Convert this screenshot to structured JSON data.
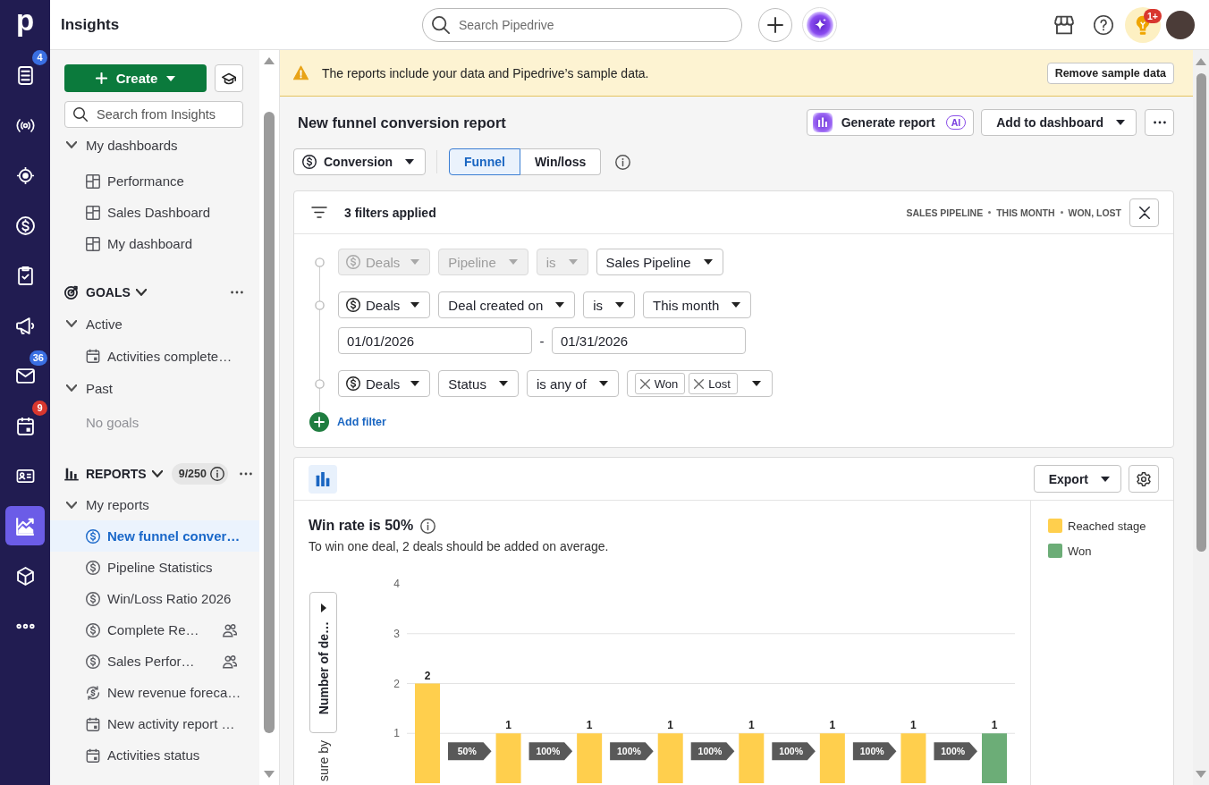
{
  "nav": {
    "logo": "p",
    "items": [
      {
        "kind": "leads",
        "selected": false,
        "badge": {
          "text": "4",
          "color": "#3a6fe2"
        }
      },
      {
        "kind": "broadcast",
        "selected": false
      },
      {
        "kind": "target",
        "selected": false
      },
      {
        "kind": "deals",
        "selected": false
      },
      {
        "kind": "activities",
        "selected": false
      },
      {
        "kind": "campaigns",
        "selected": false
      },
      {
        "kind": "mail",
        "selected": false,
        "badge": {
          "text": "36",
          "color": "#3a6fe2"
        }
      },
      {
        "kind": "calendar",
        "selected": false,
        "badge": {
          "text": "9",
          "color": "#d8372f"
        }
      },
      {
        "kind": "contacts",
        "selected": false
      },
      {
        "kind": "insights",
        "selected": true
      },
      {
        "kind": "products",
        "selected": false
      },
      {
        "kind": "more",
        "selected": false
      }
    ]
  },
  "top_bar": {
    "title": "Insights",
    "search": {
      "placeholder": "Search Pipedrive"
    },
    "tips_badge": "1+"
  },
  "sidebar": {
    "create_button": "Create",
    "search": {
      "placeholder": "Search from Insights"
    },
    "dashboards": {
      "title": "My dashboards",
      "expanded": true,
      "items": [
        {
          "label": "Performance",
          "kind": "dashboard",
          "selected": false
        },
        {
          "label": "Sales Dashboard",
          "kind": "dashboard",
          "selected": false
        },
        {
          "label": "My dashboard",
          "kind": "dashboard",
          "selected": false
        }
      ]
    },
    "goals": {
      "title": "GOALS",
      "expanded": true,
      "groups": [
        {
          "label": "Active",
          "expanded": true,
          "children": [
            {
              "label": "Activities complete…",
              "kind": "activity",
              "selected": false
            }
          ]
        },
        {
          "label": "Past",
          "expanded": true,
          "empty_text": "No goals"
        }
      ]
    },
    "reports": {
      "title": "REPORTS",
      "expanded": true,
      "count": "9/250",
      "groups": [
        {
          "label": "My reports",
          "expanded": true,
          "children": [
            {
              "label": "New funnel conver…",
              "kind": "deal",
              "selected": true,
              "shared": false
            },
            {
              "label": "Pipeline Statistics",
              "kind": "deal",
              "selected": false,
              "shared": false
            },
            {
              "label": "Win/Loss Ratio 2026",
              "kind": "deal",
              "selected": false,
              "shared": false
            },
            {
              "label": "Complete Re…",
              "kind": "deal",
              "selected": false,
              "shared": true
            },
            {
              "label": "Sales Perfor…",
              "kind": "deal",
              "selected": false,
              "shared": true
            },
            {
              "label": "New revenue foreca…",
              "kind": "forecast",
              "selected": false,
              "shared": false
            },
            {
              "label": "New activity report …",
              "kind": "activity",
              "selected": false,
              "shared": false
            },
            {
              "label": "Activities status",
              "kind": "activity",
              "selected": false,
              "shared": false
            }
          ]
        }
      ]
    }
  },
  "banner": {
    "kind": "warning",
    "text": "The reports include your data and Pipedrive’s sample data.",
    "button": "Remove sample data"
  },
  "report": {
    "title": "New funnel conversion report",
    "generate_button": {
      "label": "Generate report",
      "badge": "AI"
    },
    "dashboard_button": "Add to dashboard",
    "type_select": "Conversion",
    "tabs": [
      {
        "label": "Funnel",
        "selected": true
      },
      {
        "label": "Win/loss",
        "selected": false
      }
    ]
  },
  "filters": {
    "title": "3 filters applied",
    "summary": [
      "SALES PIPELINE",
      "THIS MONTH",
      "WON, LOST"
    ],
    "rows": [
      {
        "fields": [
          {
            "kind": "entity",
            "value": "Deals",
            "disabled": true
          },
          {
            "kind": "select",
            "value": "Pipeline",
            "disabled": true
          },
          {
            "kind": "select",
            "value": "is",
            "disabled": true
          },
          {
            "kind": "select",
            "value": "Sales Pipeline",
            "disabled": false
          }
        ]
      },
      {
        "fields": [
          {
            "kind": "entity",
            "value": "Deals",
            "disabled": false
          },
          {
            "kind": "select",
            "value": "Deal created on",
            "disabled": false
          },
          {
            "kind": "select",
            "value": "is",
            "disabled": false
          },
          {
            "kind": "select",
            "value": "This month",
            "disabled": false
          }
        ],
        "date_range": {
          "from": "01/01/2026",
          "separator": "-",
          "to": "01/31/2026"
        }
      },
      {
        "fields": [
          {
            "kind": "entity",
            "value": "Deals",
            "disabled": false
          },
          {
            "kind": "select",
            "value": "Status",
            "disabled": false
          },
          {
            "kind": "select",
            "value": "is any of",
            "disabled": false
          },
          {
            "kind": "tags",
            "tags": [
              "Won",
              "Lost"
            ],
            "disabled": false
          }
        ]
      }
    ],
    "add_filter": "Add filter"
  },
  "chart_panel": {
    "export_button": "Export",
    "headline": "Win rate is 50%",
    "subtitle": "To win one deal, 2 deals should be added on average.",
    "measure_button": "Number of de…",
    "measure_label": "sure by",
    "chart_data": {
      "type": "bar",
      "stacked": true,
      "series": [
        {
          "name": "Reached stage",
          "color": "#ffcf4d",
          "values": [
            2,
            1,
            1,
            1,
            1,
            1,
            1,
            null
          ]
        },
        {
          "name": "Won",
          "color": "#6cad77",
          "values": [
            null,
            null,
            null,
            null,
            null,
            null,
            null,
            1
          ]
        }
      ],
      "ylim": [
        0,
        4
      ],
      "yticks": [
        1,
        2,
        3,
        4
      ],
      "grid": true,
      "data_labels": true,
      "annotations": [
        "50%",
        "100%",
        "100%",
        "100%",
        "100%",
        "100%",
        "100%"
      ]
    }
  }
}
